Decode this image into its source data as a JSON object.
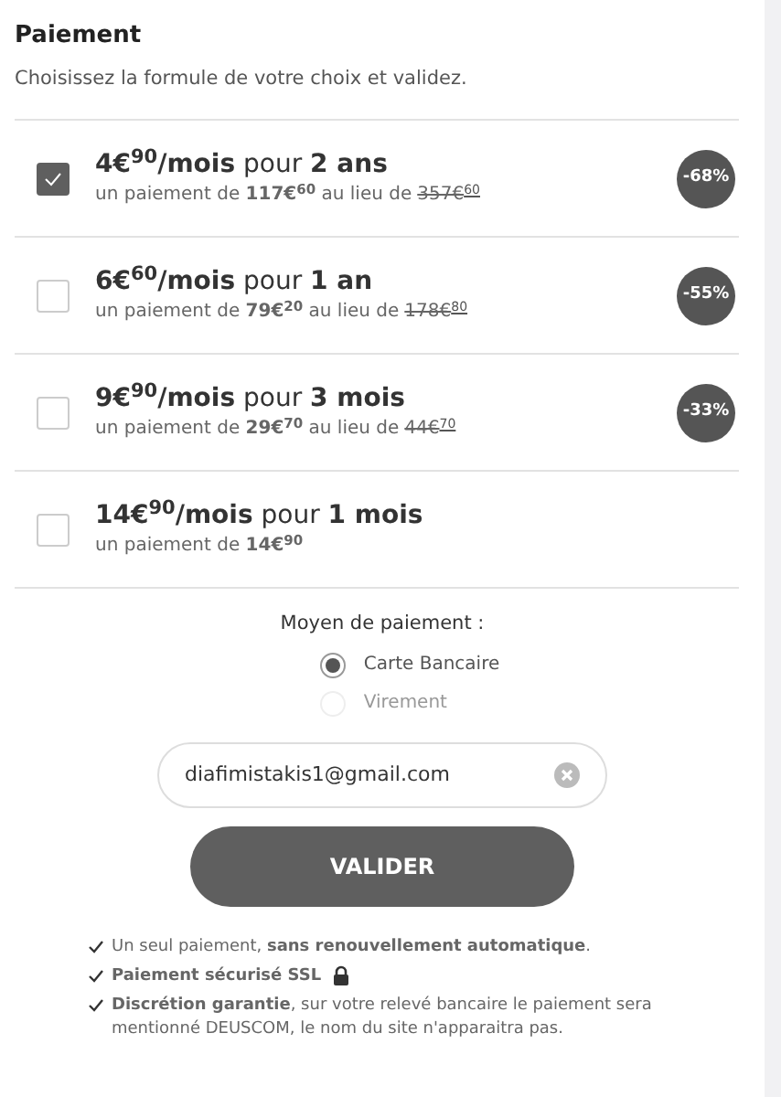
{
  "title": "Paiement",
  "subtitle": "Choisissez la formule de votre choix et validez.",
  "plans": [
    {
      "headline": "**4€$^{90}$/mois** pour **2 ans**",
      "detail": "un paiement de **117€$^{60}$** au lieu de",
      "old_price": "357€",
      "old_cents": "60",
      "discount": "-68%",
      "selected": true
    },
    {
      "headline": "**6€$^{60}$/mois** pour **1 an**",
      "detail": "un paiement de **79€$^{20}$** au lieu de",
      "old_price": "178€",
      "old_cents": "80",
      "discount": "-55%",
      "selected": false
    },
    {
      "headline": "**9€$^{90}$/mois** pour **3 mois**",
      "detail": "un paiement de **29€$^{70}$** au lieu de",
      "old_price": "44€",
      "old_cents": "70",
      "discount": "-33%",
      "selected": false
    },
    {
      "headline": "**14€$^{90}$/mois** pour **1 mois**",
      "detail": "un paiement de **14€$^{90}$**",
      "selected": false
    }
  ],
  "payment_method": {
    "label": "Moyen de paiement :",
    "options": [
      {
        "label": "Carte Bancaire",
        "selected": true,
        "disabled": false
      },
      {
        "label": "Virement",
        "selected": false,
        "disabled": true
      }
    ]
  },
  "email": {
    "value": "diafimistakis1@gmail.com"
  },
  "submit": "VALIDER",
  "assurances": [
    {
      "text": "Un seul paiement, **sans renouvellement automatique**.",
      "lock": false
    },
    {
      "text": "**Paiement sécurisé SSL**",
      "lock": true
    },
    {
      "text": "**Discrétion garantie**, sur votre relevé bancaire le paiement sera mentionné DEUSCOM, le nom du site n'apparaitra pas.",
      "lock": false
    }
  ]
}
